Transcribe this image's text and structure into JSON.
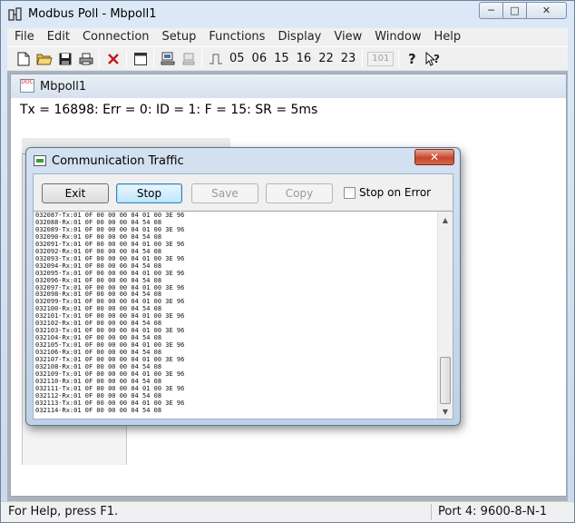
{
  "window": {
    "title": "Modbus Poll - Mbpoll1",
    "controls": {
      "minimize": "─",
      "maximize": "□",
      "close": "✕"
    }
  },
  "menubar": {
    "items": [
      "File",
      "Edit",
      "Connection",
      "Setup",
      "Functions",
      "Display",
      "View",
      "Window",
      "Help"
    ]
  },
  "toolbar": {
    "icons": [
      "new-doc-icon",
      "open-folder-icon",
      "save-icon",
      "print-icon",
      "delete-icon",
      "window-icon",
      "connect-icon",
      "disconnect-icon",
      "pulse-icon"
    ],
    "function_codes": [
      "05",
      "06",
      "15",
      "16",
      "22",
      "23"
    ],
    "disabled_label": "101",
    "help_icons": [
      "help-icon",
      "context-help-icon"
    ]
  },
  "child": {
    "title": "Mbpoll1",
    "status_line": "Tx = 16898: Err = 0: ID = 1: F = 15: SR = 5ms"
  },
  "dialog": {
    "title": "Communication Traffic",
    "buttons": {
      "exit": "Exit",
      "stop": "Stop",
      "save": "Save",
      "copy": "Copy"
    },
    "checkbox_label": "Stop on Error",
    "log": [
      "032087-Tx:01 0F 00 00 00 04 01 00 3E 96",
      "032088-Rx:01 0F 00 00 00 04 54 08",
      "032089-Tx:01 0F 00 00 00 04 01 00 3E 96",
      "032090-Rx:01 0F 00 00 00 04 54 08",
      "032091-Tx:01 0F 00 00 00 04 01 00 3E 96",
      "032092-Rx:01 0F 00 00 00 04 54 08",
      "032093-Tx:01 0F 00 00 00 04 01 00 3E 96",
      "032094-Rx:01 0F 00 00 00 04 54 08",
      "032095-Tx:01 0F 00 00 00 04 01 00 3E 96",
      "032096-Rx:01 0F 00 00 00 04 54 08",
      "032097-Tx:01 0F 00 00 00 04 01 00 3E 96",
      "032098-Rx:01 0F 00 00 00 04 54 08",
      "032099-Tx:01 0F 00 00 00 04 01 00 3E 96",
      "032100-Rx:01 0F 00 00 00 04 54 08",
      "032101-Tx:01 0F 00 00 00 04 01 00 3E 96",
      "032102-Rx:01 0F 00 00 00 04 54 08",
      "032103-Tx:01 0F 00 00 00 04 01 00 3E 96",
      "032104-Rx:01 0F 00 00 00 04 54 08",
      "032105-Tx:01 0F 00 00 00 04 01 00 3E 96",
      "032106-Rx:01 0F 00 00 00 04 54 08",
      "032107-Tx:01 0F 00 00 00 04 01 00 3E 96",
      "032108-Rx:01 0F 00 00 00 04 54 08",
      "032109-Tx:01 0F 00 00 00 04 01 00 3E 96",
      "032110-Rx:01 0F 00 00 00 04 54 08",
      "032111-Tx:01 0F 00 00 00 04 01 00 3E 96",
      "032112-Rx:01 0F 00 00 00 04 54 08",
      "032113-Tx:01 0F 00 00 00 04 01 00 3E 96",
      "032114-Rx:01 0F 00 00 00 04 54 08"
    ]
  },
  "statusbar": {
    "help_text": "For Help, press F1.",
    "port_text": "Port 4: 9600-8-N-1"
  }
}
